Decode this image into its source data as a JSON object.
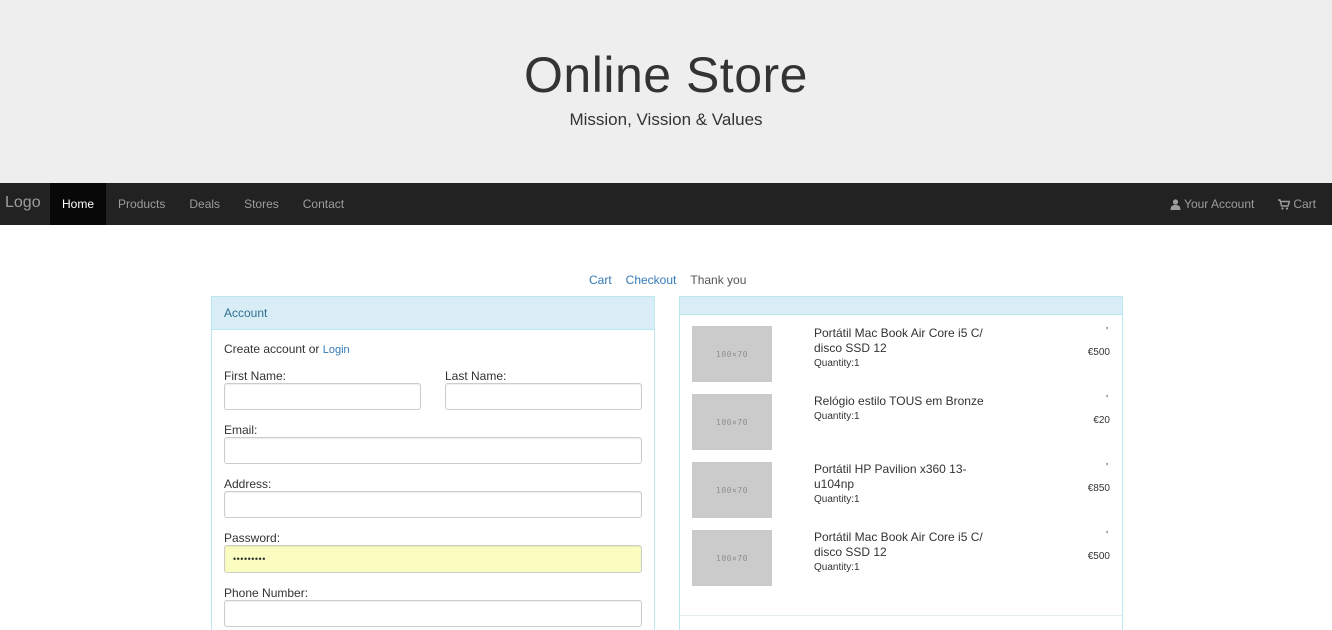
{
  "header": {
    "title": "Online Store",
    "subtitle": "Mission, Vission & Values"
  },
  "navbar": {
    "brand": "Logo",
    "items": [
      {
        "label": "Home",
        "active": true
      },
      {
        "label": "Products"
      },
      {
        "label": "Deals"
      },
      {
        "label": "Stores"
      },
      {
        "label": "Contact"
      }
    ],
    "account": {
      "label": "Your Account",
      "icon": "user-icon"
    },
    "cart": {
      "label": "Cart",
      "icon": "shopping-cart-icon"
    }
  },
  "steps": {
    "cart": "Cart",
    "checkout": "Checkout",
    "thank_you": "Thank you"
  },
  "account_panel": {
    "title": "Account",
    "create_text": "Create account or",
    "login_link": "Login",
    "fields": {
      "first_name": {
        "label": "First Name:",
        "value": ""
      },
      "last_name": {
        "label": "Last Name:",
        "value": ""
      },
      "email": {
        "label": "Email:",
        "value": ""
      },
      "address": {
        "label": "Address:",
        "value": ""
      },
      "password": {
        "label": "Password:",
        "value": "•••••••••"
      },
      "phone": {
        "label": "Phone Number:",
        "value": ""
      }
    }
  },
  "cart_items": [
    {
      "thumb": "100×70",
      "name": "Portátil Mac Book Air Core i5 C/ disco SSD 12",
      "quantity": "Quantity:1",
      "mark": "'",
      "price": "€500"
    },
    {
      "thumb": "100×70",
      "name": "Relógio estilo TOUS em Bronze",
      "quantity": "Quantity:1",
      "mark": "'",
      "price": "€20"
    },
    {
      "thumb": "100×70",
      "name": "Portátil HP Pavilion x360 13-u104np",
      "quantity": "Quantity:1",
      "mark": "'",
      "price": "€850"
    },
    {
      "thumb": "100×70",
      "name": "Portátil Mac Book Air Core i5 C/ disco SSD 12",
      "quantity": "Quantity:1",
      "mark": "'",
      "price": "€500"
    }
  ],
  "colors": {
    "navbar_bg": "#222222",
    "panel_heading_bg": "#d9edf7",
    "link": "#337ab7",
    "autofill": "#fafdbf"
  }
}
